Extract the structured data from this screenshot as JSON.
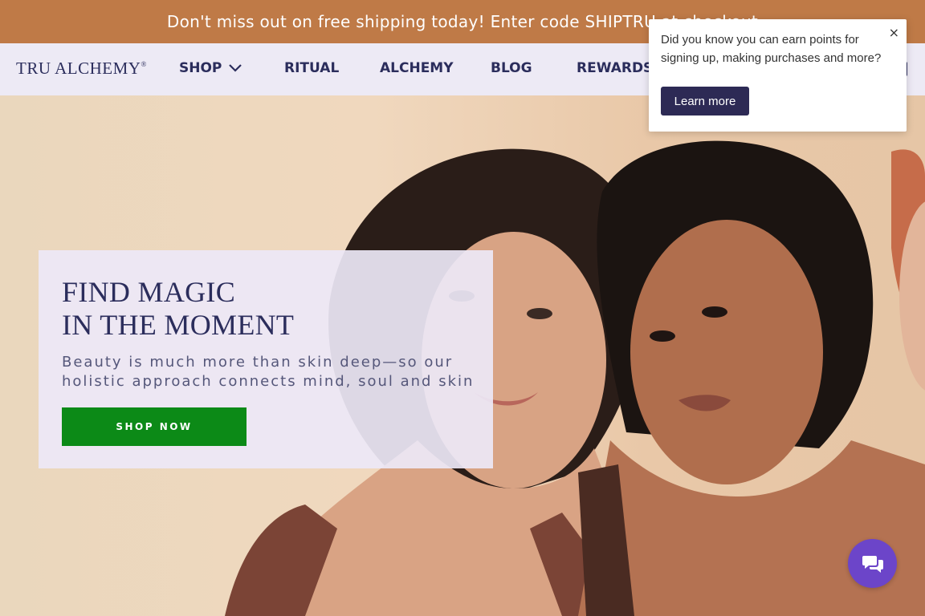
{
  "announcement": {
    "text": "Don't miss out on free shipping today! Enter code SHIPTRU at checkout"
  },
  "header": {
    "logo": "TRU ALCHEMY",
    "logo_mark": "®",
    "nav": [
      {
        "label": "SHOP",
        "icon": "chevron-down-icon"
      },
      {
        "label": "RITUAL"
      },
      {
        "label": "ALCHEMY"
      },
      {
        "label": "BLOG"
      },
      {
        "label": "REWARDS"
      }
    ]
  },
  "hero": {
    "title_line1": "FIND MAGIC",
    "title_line2": "IN THE MOMENT",
    "subtitle": "Beauty is much more than skin deep—so our holistic approach connects mind, soul and skin",
    "cta": "SHOP NOW"
  },
  "popup": {
    "text": "Did you know you can earn points for signing up, making purchases and more?",
    "close": "×",
    "button": "Learn more"
  },
  "chat": {
    "icon": "chat-bubbles-icon"
  },
  "colors": {
    "announcement_bg": "#bf7a47",
    "header_bg": "#edeaf5",
    "brand_navy": "#2b2d5c",
    "cta_green": "#0c8a17",
    "popup_button": "#2d2a55",
    "chat_purple": "#6c45c9"
  }
}
